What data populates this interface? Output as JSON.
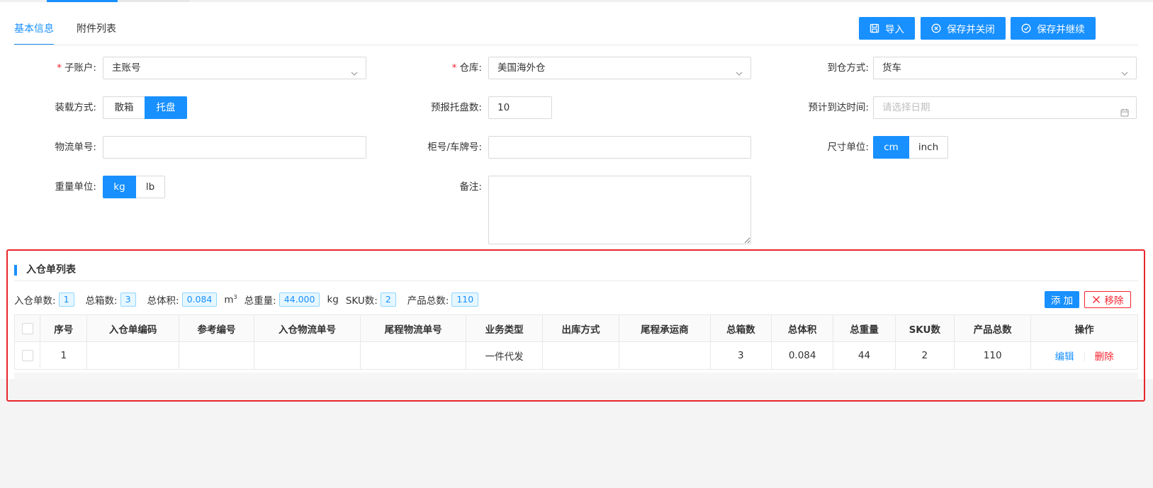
{
  "tabs": [
    {
      "label": "基本信息",
      "active": true
    },
    {
      "label": "附件列表",
      "active": false
    }
  ],
  "toolbar": {
    "import_label": "导入",
    "save_close_label": "保存并关闭",
    "save_continue_label": "保存并继续"
  },
  "form": {
    "sub_account": {
      "label": "子账户:",
      "value": "主账号",
      "required": true
    },
    "warehouse": {
      "label": "仓库:",
      "value": "美国海外仓",
      "required": true
    },
    "arrival_method": {
      "label": "到仓方式:",
      "value": "货车"
    },
    "loading_method": {
      "label": "装载方式:",
      "options": [
        "散箱",
        "托盘"
      ],
      "selected": "托盘"
    },
    "pallet_count": {
      "label": "预报托盘数:",
      "value": "10"
    },
    "eta": {
      "label": "预计到达时间:",
      "placeholder": "请选择日期"
    },
    "tracking_no": {
      "label": "物流单号:",
      "value": ""
    },
    "container_no": {
      "label": "柜号/车牌号:",
      "value": ""
    },
    "size_unit": {
      "label": "尺寸单位:",
      "options": [
        "cm",
        "inch"
      ],
      "selected": "cm"
    },
    "weight_unit": {
      "label": "重量单位:",
      "options": [
        "kg",
        "lb"
      ],
      "selected": "kg"
    },
    "remark": {
      "label": "备注:",
      "value": ""
    }
  },
  "section": {
    "title": "入仓单列表",
    "stats": {
      "order_count_label": "入仓单数:",
      "order_count": "1",
      "box_count_label": "总箱数:",
      "box_count": "3",
      "volume_label": "总体积:",
      "volume": "0.084",
      "volume_unit": "m",
      "weight_label": "总重量:",
      "weight": "44.000",
      "weight_unit": "kg",
      "sku_label": "SKU数:",
      "sku": "2",
      "product_label": "产品总数:",
      "product": "110"
    },
    "add_label": "添 加",
    "remove_label": "移除"
  },
  "table": {
    "columns": [
      "序号",
      "入仓单编码",
      "参考编号",
      "入仓物流单号",
      "尾程物流单号",
      "业务类型",
      "出库方式",
      "尾程承运商",
      "总箱数",
      "总体积",
      "总重量",
      "SKU数",
      "产品总数",
      "操作"
    ],
    "rows": [
      {
        "index": "1",
        "code": "",
        "ref": "",
        "inbound_tracking": "",
        "last_mile_tracking": "",
        "business_type": "一件代发",
        "outbound_method": "",
        "carrier": "",
        "boxes": "3",
        "volume": "0.084",
        "weight": "44",
        "sku": "2",
        "products": "110",
        "edit": "编辑",
        "delete": "删除"
      }
    ]
  },
  "colors": {
    "primary": "#1890ff",
    "danger": "#f5222d",
    "highlight_border": "#e8262a"
  }
}
